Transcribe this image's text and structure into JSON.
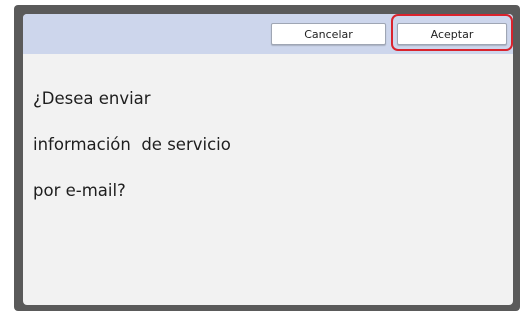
{
  "dialog": {
    "message_lines": [
      "¿Desea enviar",
      "información  de servicio",
      "por e-mail?"
    ]
  },
  "buttons": {
    "cancel_label": "Cancelar",
    "accept_label": "Aceptar"
  },
  "colors": {
    "topbar": "#cdd6ec",
    "screen_bg": "#f2f2f2",
    "highlight": "#d9232d",
    "bezel": "#5a5a5a"
  }
}
